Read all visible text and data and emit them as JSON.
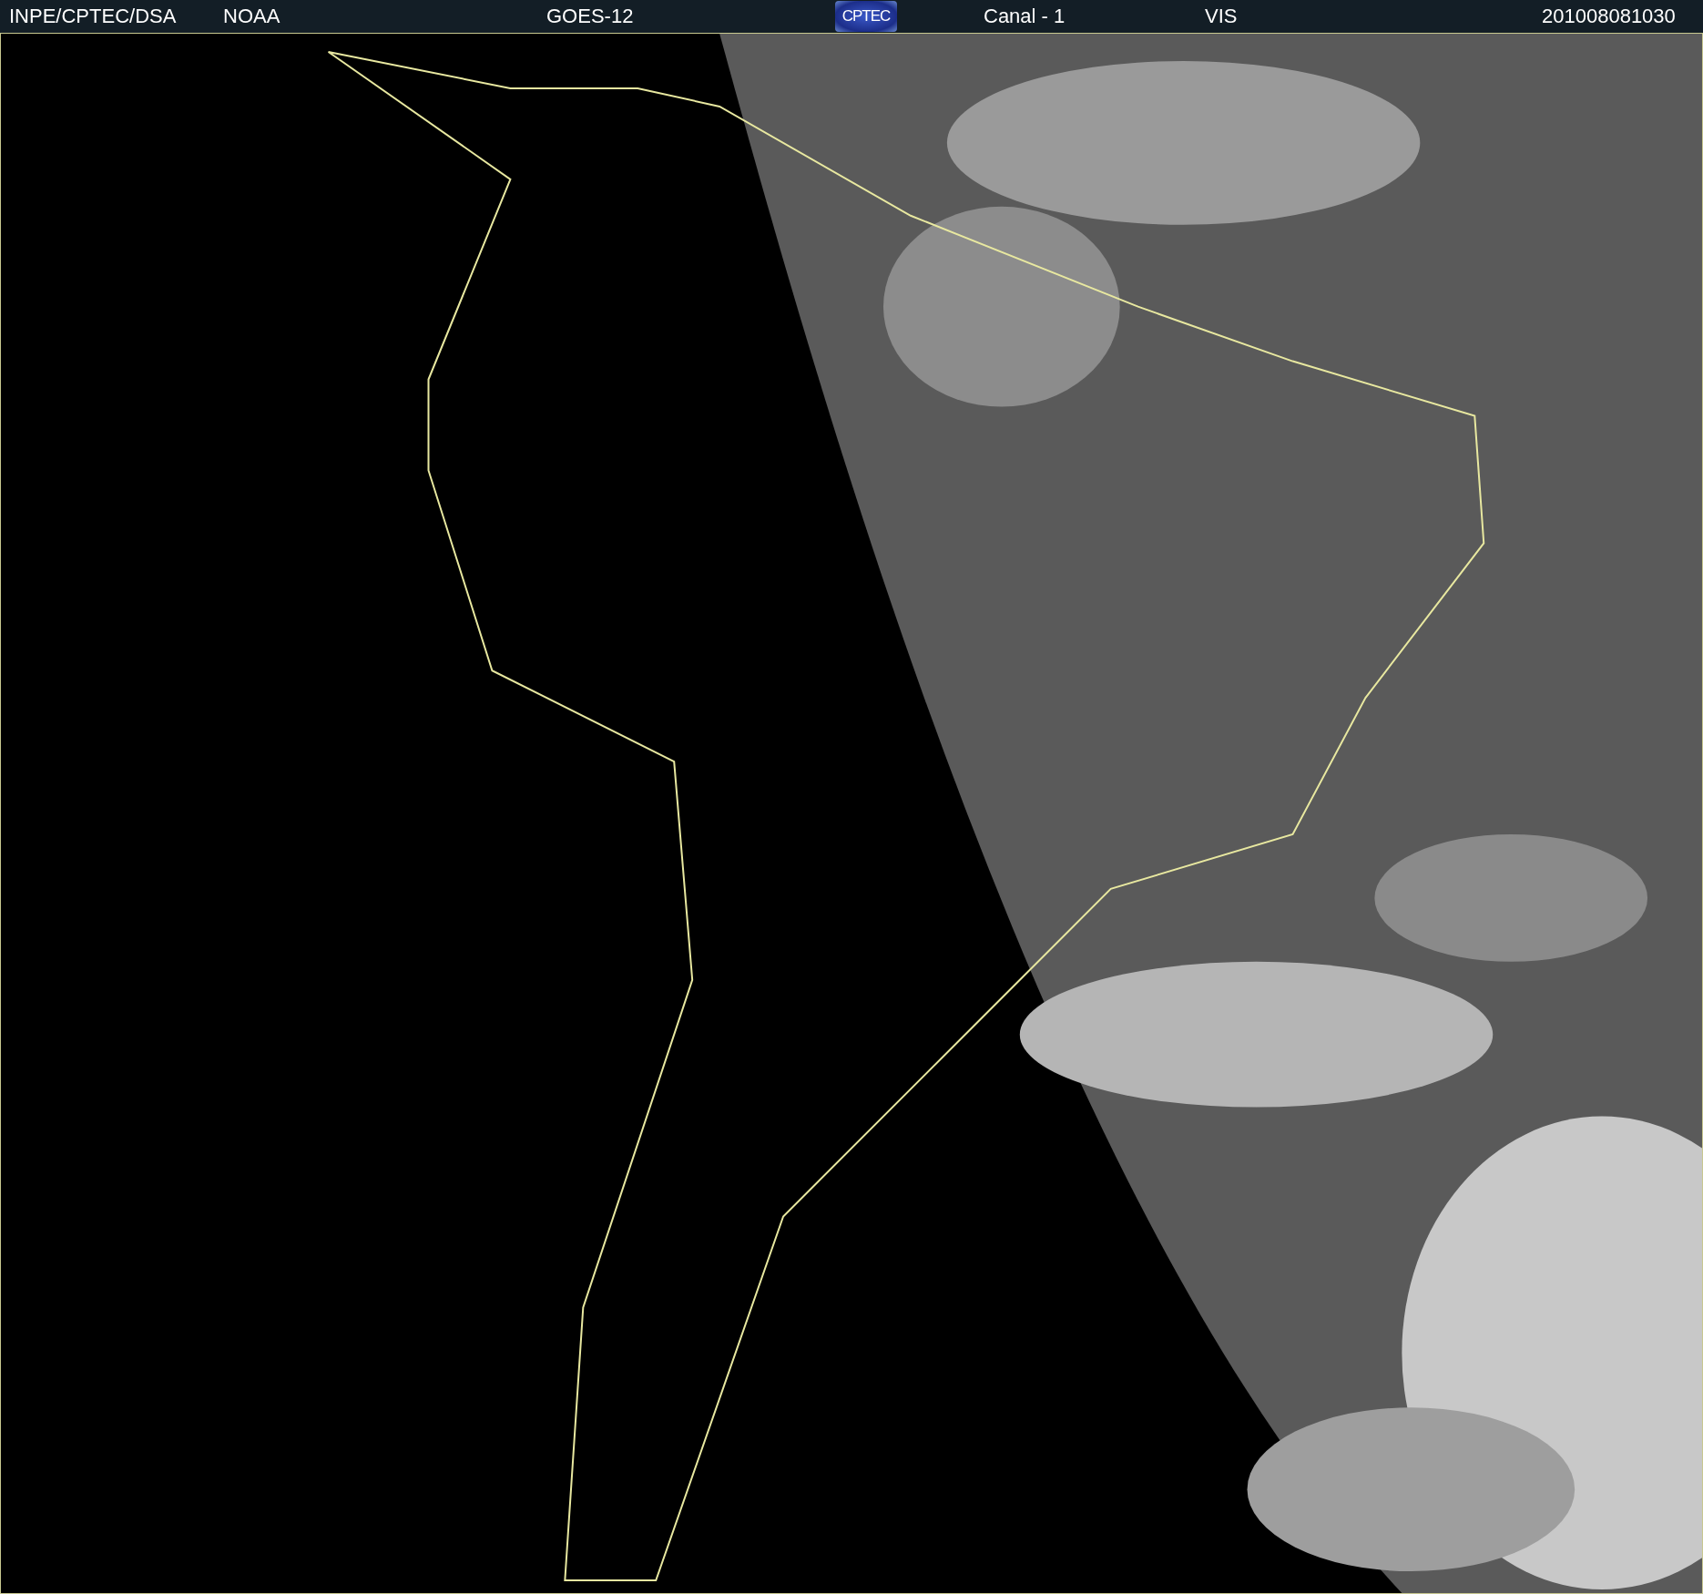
{
  "header": {
    "agency": "INPE/CPTEC/DSA",
    "provider": "NOAA",
    "satellite": "GOES-12",
    "logo": "CPTEC",
    "channel": "Canal - 1",
    "band": "VIS",
    "timestamp": "201008081030"
  }
}
